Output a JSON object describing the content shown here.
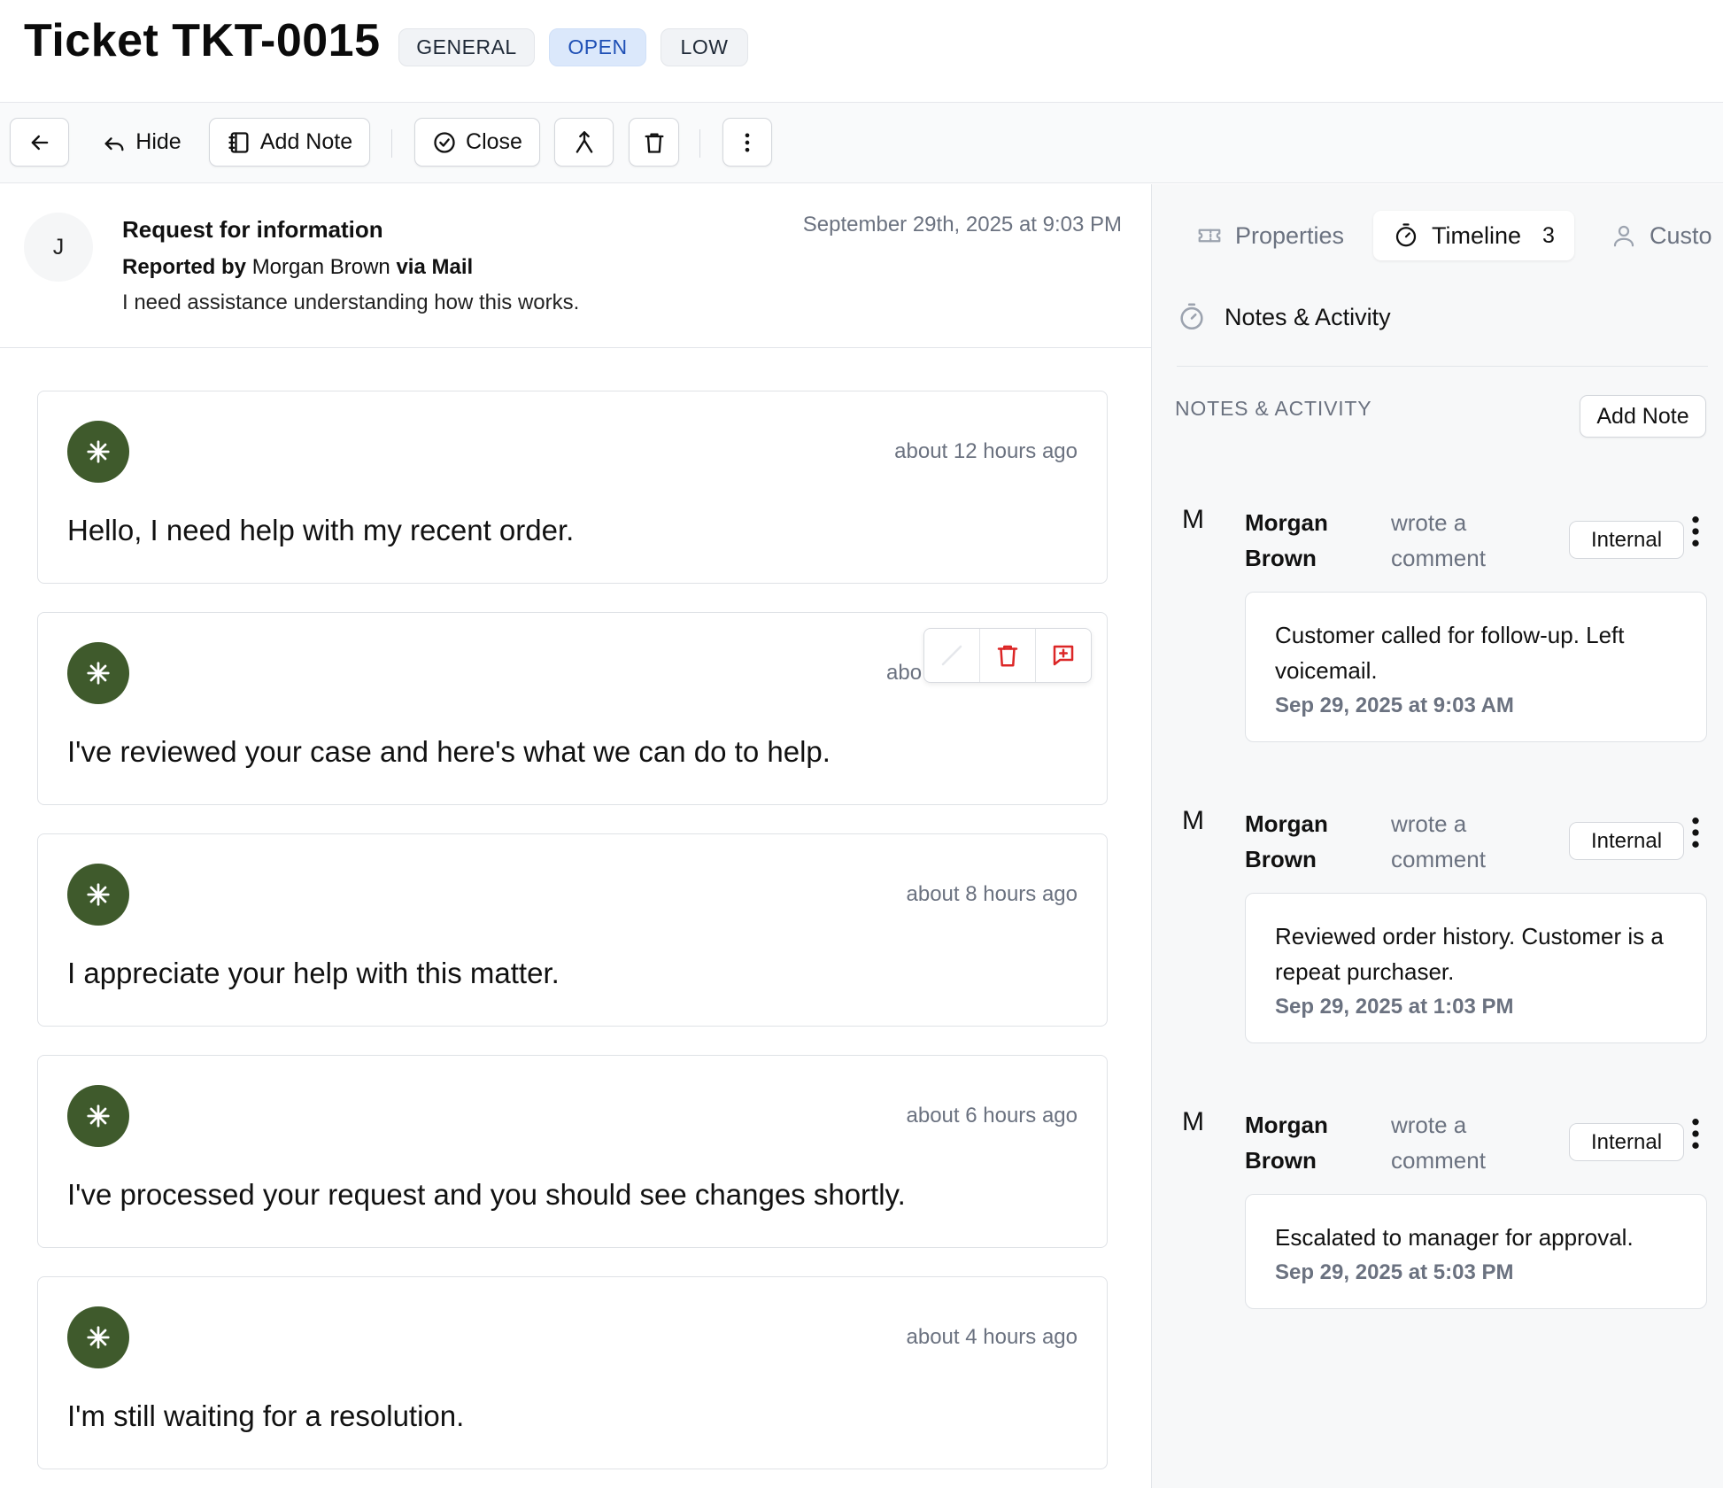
{
  "header": {
    "title": "Ticket TKT-0015",
    "badges": [
      "GENERAL",
      "OPEN",
      "LOW"
    ]
  },
  "toolbar": {
    "back_icon": "arrow-left-icon",
    "hide_label": "Hide",
    "add_note_label": "Add Note",
    "close_label": "Close",
    "merge_icon": "merge-icon",
    "delete_icon": "trash-icon",
    "more_icon": "more-vertical-icon"
  },
  "ticket": {
    "avatar_initial": "J",
    "title": "Request for information",
    "reported_prefix": "Reported by",
    "reporter": "Morgan Brown",
    "via_prefix": "via",
    "channel": "Mail",
    "description": "I need assistance understanding how this works.",
    "date": "September 29th, 2025 at 9:03 PM"
  },
  "messages": [
    {
      "time": "about 12 hours ago",
      "text": "Hello, I need help with my recent order."
    },
    {
      "time": "abo",
      "text": "I've reviewed your case and here's what we can do to help."
    },
    {
      "time": "about 8 hours ago",
      "text": "I appreciate your help with this matter."
    },
    {
      "time": "about 6 hours ago",
      "text": "I've processed your request and you should see changes shortly."
    },
    {
      "time": "about 4 hours ago",
      "text": "I'm still waiting for a resolution."
    }
  ],
  "sidebar": {
    "tabs": [
      {
        "label": "Properties",
        "icon": "ticket-icon"
      },
      {
        "label": "Timeline",
        "icon": "stopwatch-icon",
        "count": "3"
      },
      {
        "label": "Custo",
        "icon": "user-icon"
      }
    ],
    "section_title": "Notes & Activity",
    "notes_label": "NOTES & ACTIVITY",
    "add_note_label": "Add Note",
    "notes": [
      {
        "initial": "M",
        "author_first": "Morgan",
        "author_last": "Brown",
        "action_1": "wrote a",
        "action_2": "comment",
        "badge": "Internal",
        "body": "Customer called for follow-up. Left voicemail.",
        "date": "Sep 29, 2025 at 9:03 AM"
      },
      {
        "initial": "M",
        "author_first": "Morgan",
        "author_last": "Brown",
        "action_1": "wrote a",
        "action_2": "comment",
        "badge": "Internal",
        "body": "Reviewed order history. Customer is a repeat purchaser.",
        "date": "Sep 29, 2025 at 1:03 PM"
      },
      {
        "initial": "M",
        "author_first": "Morgan",
        "author_last": "Brown",
        "action_1": "wrote a",
        "action_2": "comment",
        "badge": "Internal",
        "body": "Escalated to manager for approval.",
        "date": "Sep 29, 2025 at 5:03 PM"
      }
    ]
  },
  "colors": {
    "avatar_green": "#3f5a2c",
    "open_badge_bg": "#dbe8fb",
    "open_badge_text": "#1e4fb5",
    "danger_red": "#dc2626"
  }
}
